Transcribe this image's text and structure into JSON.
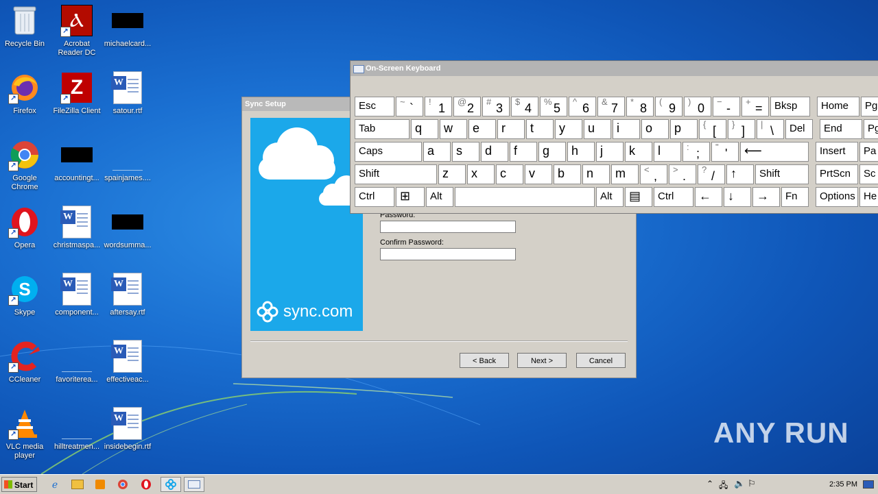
{
  "desktop": {
    "icons": [
      {
        "label": "Recycle Bin"
      },
      {
        "label": "Acrobat Reader DC"
      },
      {
        "label": "michaelcard..."
      },
      {
        "label": "Firefox"
      },
      {
        "label": "FileZilla Client"
      },
      {
        "label": "satour.rtf"
      },
      {
        "label": "Google Chrome"
      },
      {
        "label": "accountingt..."
      },
      {
        "label": "spainjames...."
      },
      {
        "label": "Opera"
      },
      {
        "label": "christmaspa..."
      },
      {
        "label": "wordsumma..."
      },
      {
        "label": "Skype"
      },
      {
        "label": "component..."
      },
      {
        "label": "aftersay.rtf"
      },
      {
        "label": "CCleaner"
      },
      {
        "label": "favoriterea..."
      },
      {
        "label": "effectiveac..."
      },
      {
        "label": "VLC media player"
      },
      {
        "label": "hilltreatmen..."
      },
      {
        "label": "insidebegin.rtf"
      }
    ]
  },
  "sync_setup": {
    "title": "Sync Setup",
    "brand": "sync.com",
    "password_label": "Password:",
    "confirm_label": "Confirm Password:",
    "back": "< Back",
    "next": "Next >",
    "cancel": "Cancel"
  },
  "osk": {
    "title": "On-Screen Keyboard",
    "rows": [
      [
        [
          "Esc",
          ""
        ],
        [
          "`",
          "~"
        ],
        [
          "1",
          "!"
        ],
        [
          "2",
          "@"
        ],
        [
          "3",
          "#"
        ],
        [
          "4",
          "$"
        ],
        [
          "5",
          "%"
        ],
        [
          "6",
          "^"
        ],
        [
          "7",
          "&"
        ],
        [
          "8",
          "*"
        ],
        [
          "9",
          "("
        ],
        [
          "0",
          ")"
        ],
        [
          "-",
          "−"
        ],
        [
          "=",
          "+"
        ],
        [
          "Bksp",
          ""
        ],
        [
          "Home",
          ""
        ],
        [
          "Pg",
          ""
        ]
      ],
      [
        [
          "Tab",
          ""
        ],
        [
          "q",
          ""
        ],
        [
          "w",
          ""
        ],
        [
          "e",
          ""
        ],
        [
          "r",
          ""
        ],
        [
          "t",
          ""
        ],
        [
          "y",
          ""
        ],
        [
          "u",
          ""
        ],
        [
          "i",
          ""
        ],
        [
          "o",
          ""
        ],
        [
          "p",
          ""
        ],
        [
          "[",
          "{"
        ],
        [
          "]",
          "}"
        ],
        [
          "\\",
          "|"
        ],
        [
          "Del",
          ""
        ],
        [
          "End",
          ""
        ],
        [
          "Pg",
          ""
        ]
      ],
      [
        [
          "Caps",
          ""
        ],
        [
          "a",
          ""
        ],
        [
          "s",
          ""
        ],
        [
          "d",
          ""
        ],
        [
          "f",
          ""
        ],
        [
          "g",
          ""
        ],
        [
          "h",
          ""
        ],
        [
          "j",
          ""
        ],
        [
          "k",
          ""
        ],
        [
          "l",
          ""
        ],
        [
          ";",
          ":"
        ],
        [
          "'",
          "\""
        ],
        [
          "⟵",
          ""
        ],
        [
          "Insert",
          ""
        ],
        [
          "Pa",
          ""
        ]
      ],
      [
        [
          "Shift",
          ""
        ],
        [
          "z",
          ""
        ],
        [
          "x",
          ""
        ],
        [
          "c",
          ""
        ],
        [
          "v",
          ""
        ],
        [
          "b",
          ""
        ],
        [
          "n",
          ""
        ],
        [
          "m",
          ""
        ],
        [
          ",",
          "<"
        ],
        [
          ".",
          ">"
        ],
        [
          "/",
          "?"
        ],
        [
          "↑",
          ""
        ],
        [
          "Shift",
          ""
        ],
        [
          "PrtScn",
          ""
        ],
        [
          "Sc",
          ""
        ]
      ],
      [
        [
          "Ctrl",
          ""
        ],
        [
          "⊞",
          ""
        ],
        [
          "Alt",
          ""
        ],
        [
          "",
          ""
        ],
        [
          "Alt",
          ""
        ],
        [
          "▤",
          ""
        ],
        [
          "Ctrl",
          ""
        ],
        [
          "←",
          ""
        ],
        [
          "↓",
          ""
        ],
        [
          "→",
          ""
        ],
        [
          "Fn",
          ""
        ],
        [
          "Options",
          ""
        ],
        [
          "He",
          ""
        ]
      ]
    ]
  },
  "taskbar": {
    "start": "Start",
    "clock": "2:35 PM"
  },
  "watermark": "ANY RUN"
}
